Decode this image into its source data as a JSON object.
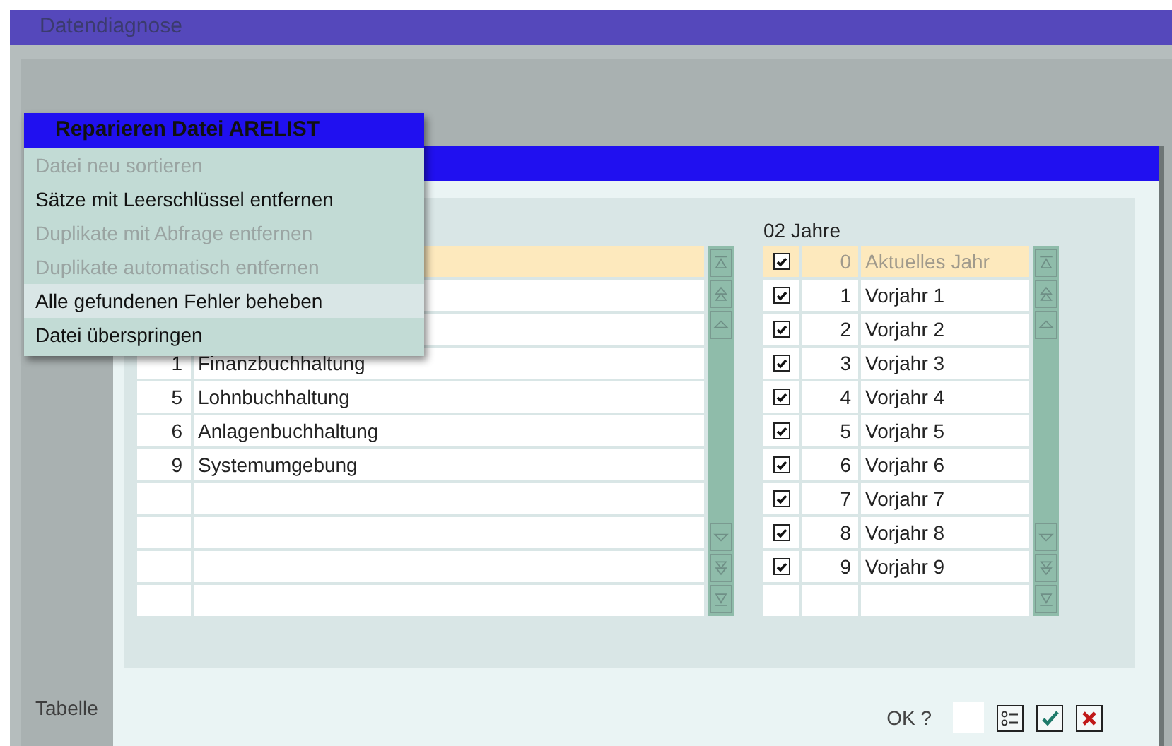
{
  "window": {
    "title": "Datendiagnose"
  },
  "menu": {
    "title": "Reparieren Datei ARELIST",
    "items": [
      {
        "label": "Datei neu sortieren",
        "disabled": true,
        "selected": false
      },
      {
        "label": "Sätze mit Leerschlüssel entfernen",
        "disabled": false,
        "selected": false
      },
      {
        "label": "Duplikate mit Abfrage entfernen",
        "disabled": true,
        "selected": false
      },
      {
        "label": "Duplikate automatisch entfernen",
        "disabled": true,
        "selected": false
      },
      {
        "label": "Alle gefundenen Fehler beheben",
        "disabled": false,
        "selected": true
      },
      {
        "label": "Datei überspringen",
        "disabled": false,
        "selected": false
      }
    ]
  },
  "left_table": {
    "rows": [
      {
        "selected": true
      },
      {
        "selected": false
      },
      {
        "selected": false
      },
      {
        "number": "1",
        "name": "Finanzbuchhaltung",
        "selected": false
      },
      {
        "number": "5",
        "name": "Lohnbuchhaltung",
        "selected": false
      },
      {
        "number": "6",
        "name": "Anlagenbuchhaltung",
        "selected": false
      },
      {
        "number": "9",
        "name": "Systemumgebung",
        "selected": false
      },
      {
        "selected": false
      },
      {
        "selected": false
      },
      {
        "selected": false
      },
      {
        "selected": false
      }
    ]
  },
  "right_table": {
    "header": "02 Jahre",
    "rows": [
      {
        "checked": true,
        "number": "0",
        "name": "Aktuelles Jahr",
        "selected": true
      },
      {
        "checked": true,
        "number": "1",
        "name": "Vorjahr 1",
        "selected": false
      },
      {
        "checked": true,
        "number": "2",
        "name": "Vorjahr 2",
        "selected": false
      },
      {
        "checked": true,
        "number": "3",
        "name": "Vorjahr 3",
        "selected": false
      },
      {
        "checked": true,
        "number": "4",
        "name": "Vorjahr 4",
        "selected": false
      },
      {
        "checked": true,
        "number": "5",
        "name": "Vorjahr 5",
        "selected": false
      },
      {
        "checked": true,
        "number": "6",
        "name": "Vorjahr 6",
        "selected": false
      },
      {
        "checked": true,
        "number": "7",
        "name": "Vorjahr 7",
        "selected": false
      },
      {
        "checked": true,
        "number": "8",
        "name": "Vorjahr 8",
        "selected": false
      },
      {
        "checked": true,
        "number": "9",
        "name": "Vorjahr 9",
        "selected": false
      },
      {
        "checked": false,
        "selected": false
      }
    ]
  },
  "side_label": "Tabelle",
  "confirm": {
    "label": "OK ?"
  }
}
